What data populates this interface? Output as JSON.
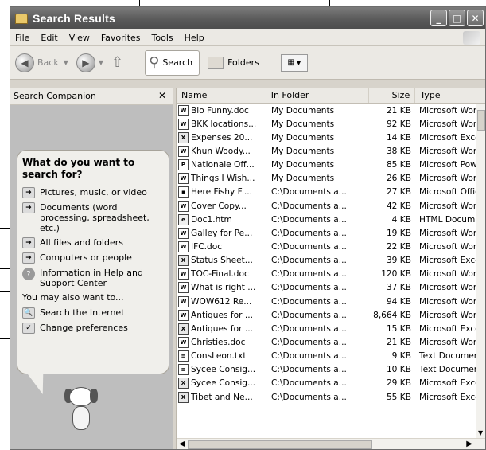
{
  "window": {
    "title": "Search Results"
  },
  "menu": [
    "File",
    "Edit",
    "View",
    "Favorites",
    "Tools",
    "Help"
  ],
  "toolbar": {
    "back": "Back",
    "search": "Search",
    "folders": "Folders"
  },
  "companion": {
    "header": "Search Companion",
    "question": "What do you want to search for?",
    "options": [
      "Pictures, music, or video",
      "Documents (word processing, spreadsheet, etc.)",
      "All files and folders",
      "Computers or people",
      "Information in Help and Support Center"
    ],
    "also": "You may also want to...",
    "extras": [
      "Search the Internet",
      "Change preferences"
    ]
  },
  "list": {
    "columns": {
      "name": "Name",
      "folder": "In Folder",
      "size": "Size",
      "type": "Type"
    },
    "rows": [
      {
        "name": "Bio Funny.doc",
        "folder": "My Documents",
        "size": "21 KB",
        "type": "Microsoft Word",
        "icon": "doc"
      },
      {
        "name": "BKK locations...",
        "folder": "My Documents",
        "size": "92 KB",
        "type": "Microsoft Word",
        "icon": "doc"
      },
      {
        "name": "Expenses 20...",
        "folder": "My Documents",
        "size": "14 KB",
        "type": "Microsoft Excel",
        "icon": "xls"
      },
      {
        "name": "Khun Woody...",
        "folder": "My Documents",
        "size": "38 KB",
        "type": "Microsoft Word",
        "icon": "doc"
      },
      {
        "name": "Nationale Off...",
        "folder": "My Documents",
        "size": "85 KB",
        "type": "Microsoft Powe",
        "icon": "ppt"
      },
      {
        "name": "Things I Wish...",
        "folder": "My Documents",
        "size": "26 KB",
        "type": "Microsoft Word",
        "icon": "doc"
      },
      {
        "name": "Here Fishy Fi...",
        "folder": "C:\\Documents a...",
        "size": "27 KB",
        "type": "Microsoft Office",
        "icon": "img"
      },
      {
        "name": "Cover Copy...",
        "folder": "C:\\Documents a...",
        "size": "42 KB",
        "type": "Microsoft Word",
        "icon": "doc"
      },
      {
        "name": "Doc1.htm",
        "folder": "C:\\Documents a...",
        "size": "4 KB",
        "type": "HTML Documen",
        "icon": "htm"
      },
      {
        "name": "Galley for Pe...",
        "folder": "C:\\Documents a...",
        "size": "19 KB",
        "type": "Microsoft Word",
        "icon": "doc"
      },
      {
        "name": "IFC.doc",
        "folder": "C:\\Documents a...",
        "size": "22 KB",
        "type": "Microsoft Word",
        "icon": "doc"
      },
      {
        "name": "Status Sheet...",
        "folder": "C:\\Documents a...",
        "size": "39 KB",
        "type": "Microsoft Excel",
        "icon": "xls"
      },
      {
        "name": "TOC-Final.doc",
        "folder": "C:\\Documents a...",
        "size": "120 KB",
        "type": "Microsoft Word",
        "icon": "doc"
      },
      {
        "name": "What is right ...",
        "folder": "C:\\Documents a...",
        "size": "37 KB",
        "type": "Microsoft Word",
        "icon": "doc"
      },
      {
        "name": "WOW612 Re...",
        "folder": "C:\\Documents a...",
        "size": "94 KB",
        "type": "Microsoft Word",
        "icon": "doc"
      },
      {
        "name": "Antiques for ...",
        "folder": "C:\\Documents a...",
        "size": "8,664 KB",
        "type": "Microsoft Word",
        "icon": "doc"
      },
      {
        "name": "Antiques for ...",
        "folder": "C:\\Documents a...",
        "size": "15 KB",
        "type": "Microsoft Excel",
        "icon": "xls"
      },
      {
        "name": "Christies.doc",
        "folder": "C:\\Documents a...",
        "size": "21 KB",
        "type": "Microsoft Word",
        "icon": "doc"
      },
      {
        "name": "ConsLeon.txt",
        "folder": "C:\\Documents a...",
        "size": "9 KB",
        "type": "Text Document",
        "icon": "txt"
      },
      {
        "name": "Sycee Consig...",
        "folder": "C:\\Documents a...",
        "size": "10 KB",
        "type": "Text Document",
        "icon": "txt"
      },
      {
        "name": "Sycee Consig...",
        "folder": "C:\\Documents a...",
        "size": "29 KB",
        "type": "Microsoft Excel",
        "icon": "xls"
      },
      {
        "name": "Tibet and Ne...",
        "folder": "C:\\Documents a...",
        "size": "55 KB",
        "type": "Microsoft Excel",
        "icon": "xls"
      }
    ]
  }
}
